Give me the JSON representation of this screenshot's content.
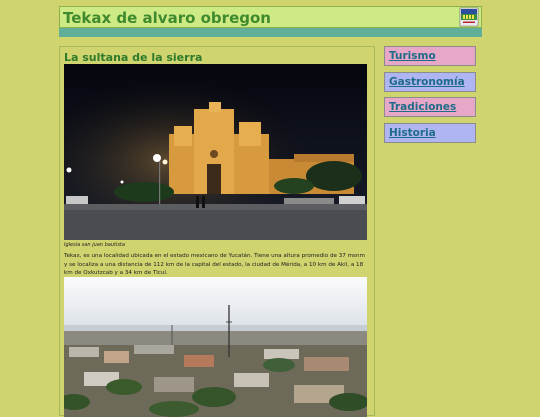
{
  "header": {
    "title": "Tekax de alvaro obregon",
    "logo_icon": "municipal-shield-icon"
  },
  "main": {
    "heading": "La sultana de la sierra",
    "photo1_caption": "Iglesia san juan bautista",
    "description": "Tekax, es una localidad ubicada en el estado mexicano de Yucatán. Tiene una altura promedio de 37 msnm y se localiza a una distancia de 112 km de la capital del estado, la ciudad de Mérida, a 10 km de Akil, a 18 km de Oxkutzcab y a 34 km de Ticul."
  },
  "nav": {
    "items": [
      {
        "label": "Turismo"
      },
      {
        "label": "Gastronomía"
      },
      {
        "label": "Tradiciones"
      },
      {
        "label": "Historia"
      }
    ]
  },
  "colors": {
    "page_bg": "#cfd46e",
    "header_bg": "#cdea84",
    "title_green": "#3f8a2d",
    "band": "#5faf99",
    "nav_pink": "#e7a7c6",
    "nav_lavender": "#aeb5f0",
    "link": "#1f6b8a"
  }
}
